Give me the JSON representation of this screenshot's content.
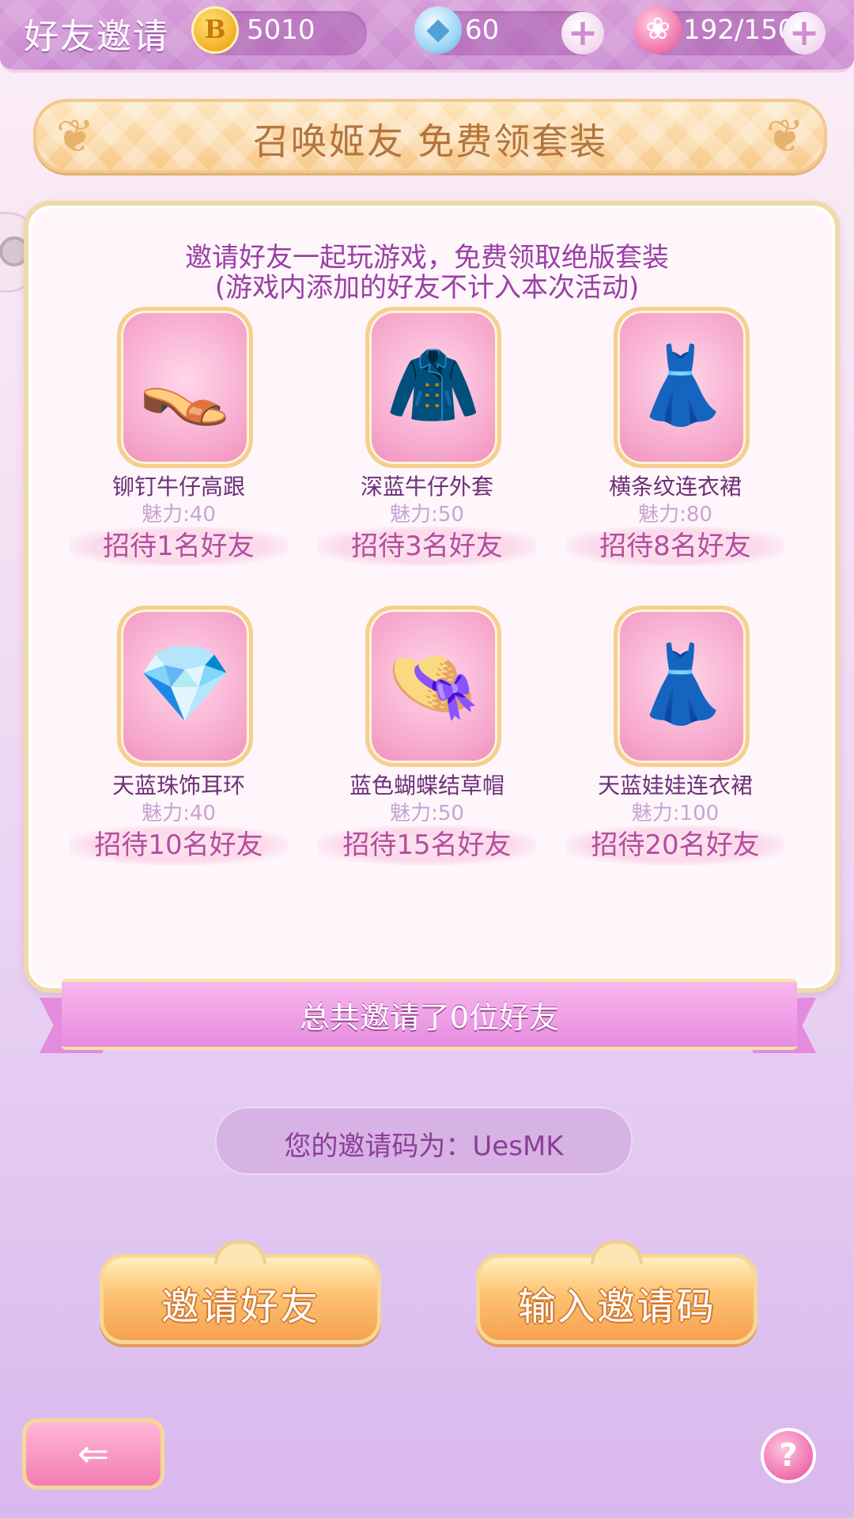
{
  "header": {
    "title": "好友邀请",
    "coins": "5010",
    "diamonds": "60",
    "stamina": "192/150",
    "icons": [
      "coin-icon",
      "diamond-icon",
      "rose-icon",
      "plus-icon"
    ]
  },
  "banner": {
    "title": "召唤姬友 免费领套装"
  },
  "panel": {
    "intro_line1": "邀请好友一起玩游戏，免费领取绝版套装",
    "intro_line2": "(游戏内添加的好友不计入本次活动)",
    "items": [
      {
        "name": "铆钉牛仔高跟",
        "charm": "魅力:40",
        "requirement": "招待1名好友",
        "icon": "shoes-icon",
        "glyph": "👡"
      },
      {
        "name": "深蓝牛仔外套",
        "charm": "魅力:50",
        "requirement": "招待3名好友",
        "icon": "jacket-icon",
        "glyph": "🧥"
      },
      {
        "name": "横条纹连衣裙",
        "charm": "魅力:80",
        "requirement": "招待8名好友",
        "icon": "dress-icon",
        "glyph": "👗"
      },
      {
        "name": "天蓝珠饰耳环",
        "charm": "魅力:40",
        "requirement": "招待10名好友",
        "icon": "earrings-icon",
        "glyph": "💎"
      },
      {
        "name": "蓝色蝴蝶结草帽",
        "charm": "魅力:50",
        "requirement": "招待15名好友",
        "icon": "hat-icon",
        "glyph": "👒"
      },
      {
        "name": "天蓝娃娃连衣裙",
        "charm": "魅力:100",
        "requirement": "招待20名好友",
        "icon": "doll-dress-icon",
        "glyph": "👗"
      }
    ]
  },
  "ribbon": {
    "text": "总共邀请了0位好友"
  },
  "invite_code": {
    "text": "您的邀请码为：UesMK"
  },
  "buttons": {
    "invite_friends": "邀请好友",
    "enter_code": "输入邀请码",
    "back_glyph": "⇐",
    "help_glyph": "?"
  },
  "colors": {
    "accent_purple": "#9a3fa5",
    "requirement_pink": "#b34e9e",
    "button_orange": "#f6a14e"
  }
}
